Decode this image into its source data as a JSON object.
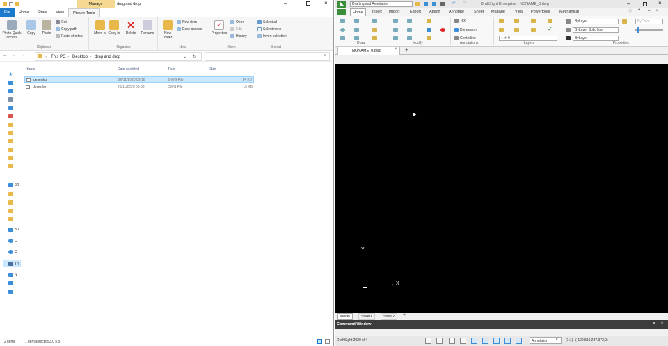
{
  "explorer": {
    "title_tabs": {
      "manage": "Manage",
      "folder": "drag and drop"
    },
    "tabs": [
      "File",
      "Home",
      "Share",
      "View",
      "Picture Tools"
    ],
    "ribbon": {
      "clipboard": {
        "pin": "Pin to Quick access",
        "copy": "Copy",
        "paste": "Paste",
        "cut": "Cut",
        "copy_path": "Copy path",
        "paste_shortcut": "Paste shortcut",
        "label": "Clipboard"
      },
      "organise": {
        "move": "Move to",
        "copy": "Copy to",
        "delete": "Delete",
        "rename": "Rename",
        "label": "Organise"
      },
      "new": {
        "folder": "New folder",
        "item": "New item",
        "easy": "Easy access",
        "label": "New"
      },
      "open": {
        "properties": "Properties",
        "open": "Open",
        "edit": "Edit",
        "history": "History",
        "label": "Open"
      },
      "select": {
        "all": "Select all",
        "none": "Select none",
        "invert": "Invert selection",
        "label": "Select"
      }
    },
    "address": {
      "crumbs": [
        "This PC",
        "Desktop",
        "drag and drop"
      ]
    },
    "columns": {
      "name": "Name",
      "date": "Date modified",
      "type": "Type",
      "size": "Size"
    },
    "files": [
      {
        "name": "desenho",
        "date": "26/11/2020 09:18",
        "type": "DWG File",
        "size": "14 KB",
        "selected": true
      },
      {
        "name": "desenho",
        "date": "26/11/2020 09:33",
        "type": "DWG File",
        "size": "15 KB",
        "selected": false
      }
    ],
    "nav_labels": [
      "3D",
      "3D",
      "O",
      "Q",
      "Th",
      "N"
    ],
    "status": {
      "items": "2 items",
      "selected": "1 item selected  3.0 KB"
    }
  },
  "draftsight": {
    "workspace": "Drafting and Annotation",
    "title": "DraftSight Enterprise - NONAME_0.dwg",
    "tabs": [
      "Home",
      "Insert",
      "Import",
      "Export",
      "Attach",
      "Annotate",
      "Sheet",
      "Manage",
      "View",
      "Powertools",
      "Mechanical"
    ],
    "ribbon": {
      "groups": [
        "Draw",
        "Modify",
        "Annotations",
        "Layers",
        "Properties"
      ],
      "annotations": {
        "text": "Text",
        "dimension": "Dimension",
        "centerline": "Centerline"
      },
      "layer_value": "0",
      "props": {
        "bylayer1": "ByLayer",
        "bylayer2": "ByLayer",
        "linetype": "Solid line",
        "bycolor": "ByColor",
        "bylayer3": "ByLayer"
      }
    },
    "document_tab": "NONAME_0.dwg",
    "sheets": [
      "Model",
      "Sheet1",
      "Sheet2"
    ],
    "ucs": {
      "x": "X",
      "y": "Y"
    },
    "command_window": "Command Window",
    "status": {
      "version": "DraftSight 2020 x64",
      "annotation": "Annotation",
      "scale": "(1:1)",
      "coords": "(-129.819,237.372,0)"
    }
  },
  "colors": {
    "file_tab": "#1979ca",
    "manage_tab": "#f5d891",
    "selection": "#cce8ff",
    "canvas": "#000000"
  }
}
